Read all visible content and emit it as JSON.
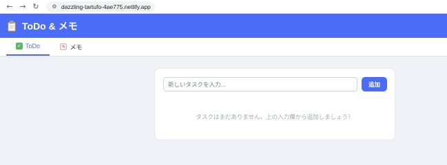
{
  "browser": {
    "back_icon": "back-arrow-icon",
    "forward_icon": "forward-arrow-icon",
    "reload_icon": "reload-icon",
    "site_info_icon": "site-settings-icon",
    "url": "dazzling-tartufo-4ae775.netlify.app"
  },
  "header": {
    "title": "ToDo & メモ",
    "logo_icon": "clipboard-icon",
    "background_color": "#4a6cf7"
  },
  "tabs": [
    {
      "label": "ToDo",
      "icon": "check-box-icon",
      "active": true
    },
    {
      "label": "メモ",
      "icon": "memo-icon",
      "active": false
    }
  ],
  "todo": {
    "input_placeholder": "新しいタスクを入力...",
    "input_value": "",
    "add_button_label": "追加",
    "empty_message": "タスクはまだありません。上の入力欄から追加しましょう！"
  },
  "colors": {
    "accent": "#4a6cf7"
  }
}
